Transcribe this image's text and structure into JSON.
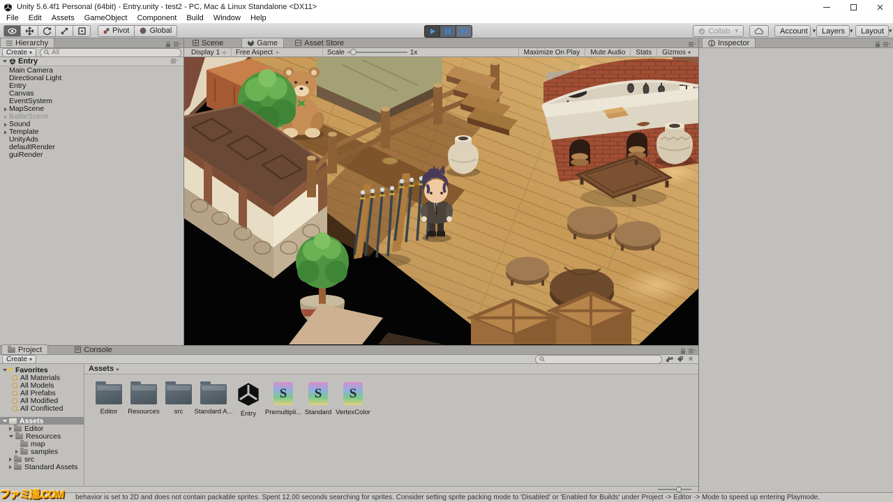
{
  "window": {
    "title": "Unity 5.6.4f1 Personal (64bit) - Entry.unity - test2 - PC, Mac & Linux Standalone <DX11>"
  },
  "menu_bar": {
    "items": [
      "File",
      "Edit",
      "Assets",
      "GameObject",
      "Component",
      "Build",
      "Window",
      "Help"
    ]
  },
  "toolbar": {
    "pivot": "Pivot",
    "global": "Global",
    "collab": "Collab",
    "account": "Account",
    "layers": "Layers",
    "layout": "Layout"
  },
  "hierarchy": {
    "tab": "Hierarchy",
    "create": "Create",
    "search_filter": "All",
    "scene_name": "Entry",
    "items": [
      {
        "label": "Main Camera"
      },
      {
        "label": "Directional Light"
      },
      {
        "label": "Entry"
      },
      {
        "label": "Canvas"
      },
      {
        "label": "EventSystem"
      },
      {
        "label": "MapScene",
        "arrow": true
      },
      {
        "label": "BattleScene",
        "arrow": true,
        "dim": true
      },
      {
        "label": "Sound",
        "arrow": true
      },
      {
        "label": "Template",
        "arrow": true
      },
      {
        "label": "UnityAds"
      },
      {
        "label": "defaultRender"
      },
      {
        "label": "guiRender"
      }
    ]
  },
  "viewport": {
    "tabs": [
      {
        "label": "Scene"
      },
      {
        "label": "Game",
        "active": true
      },
      {
        "label": "Asset Store"
      }
    ],
    "display": "Display 1",
    "aspect": "Free Aspect",
    "scale_label": "Scale",
    "scale_value": "1x",
    "maximize_on_play": "Maximize On Play",
    "mute_audio": "Mute Audio",
    "stats": "Stats",
    "gizmos": "Gizmos"
  },
  "inspector": {
    "tab": "Inspector"
  },
  "project": {
    "tab_project": "Project",
    "tab_console": "Console",
    "create": "Create",
    "favorites_label": "Favorites",
    "favorites": [
      {
        "label": "All Materials"
      },
      {
        "label": "All Models"
      },
      {
        "label": "All Prefabs"
      },
      {
        "label": "All Modified"
      },
      {
        "label": "All Conflicted"
      }
    ],
    "assets_root": "Assets",
    "tree": [
      {
        "label": "Editor",
        "indent": 1,
        "arrow": "closed"
      },
      {
        "label": "Resources",
        "indent": 1,
        "arrow": "open"
      },
      {
        "label": "map",
        "indent": 2,
        "arrow": "none"
      },
      {
        "label": "samples",
        "indent": 2,
        "arrow": "closed"
      },
      {
        "label": "src",
        "indent": 1,
        "arrow": "closed"
      },
      {
        "label": "Standard Assets",
        "indent": 1,
        "arrow": "closed"
      }
    ],
    "breadcrumb": "Assets",
    "grid": [
      {
        "label": "Editor",
        "type": "folder"
      },
      {
        "label": "Resources",
        "type": "folder"
      },
      {
        "label": "src",
        "type": "folder"
      },
      {
        "label": "Standard A...",
        "type": "folder"
      },
      {
        "label": "Entry",
        "type": "scene"
      },
      {
        "label": "Premultipli...",
        "type": "shader",
        "badge": "S"
      },
      {
        "label": "Standard",
        "type": "shader",
        "badge": "S"
      },
      {
        "label": "VertexColor",
        "type": "shader",
        "badge": "S"
      }
    ]
  },
  "status_bar": {
    "message": "behavior is set to 2D and does not contain packable sprites. Spent 12.00 seconds searching for sprites. Consider setting sprite packing mode to 'Disabled' or 'Enabled for Builds' under Project -> Editor -> Mode to speed up entering Playmode.",
    "watermark": "ファミ通.COM"
  },
  "colors": {
    "accent_blue": "#3f8fd2",
    "selection_gray": "#8f8f8f",
    "floor_wood": "#c89a58",
    "void_black": "#000000"
  }
}
